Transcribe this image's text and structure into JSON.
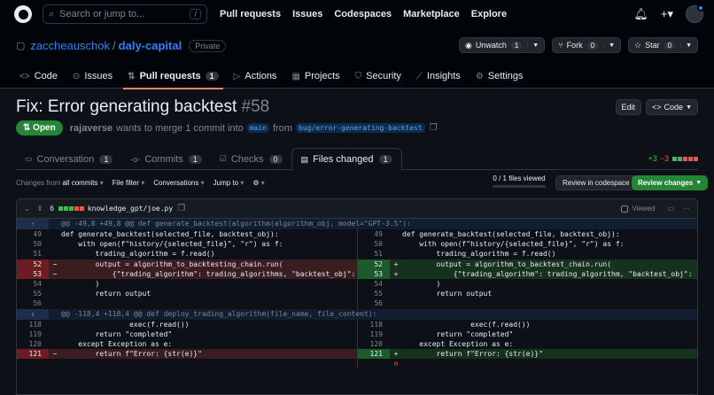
{
  "topbar": {
    "search_placeholder": "Search or jump to...",
    "search_key": "/",
    "nav": [
      "Pull requests",
      "Issues",
      "Codespaces",
      "Marketplace",
      "Explore"
    ]
  },
  "repo": {
    "owner": "zaccheauschok",
    "name": "daly-capital",
    "visibility": "Private",
    "unwatch_label": "Unwatch",
    "unwatch_count": "1",
    "fork_label": "Fork",
    "fork_count": "0",
    "star_label": "Star",
    "star_count": "0"
  },
  "repo_tabs": [
    {
      "label": "Code",
      "icon": "code-icon"
    },
    {
      "label": "Issues",
      "icon": "issues-icon"
    },
    {
      "label": "Pull requests",
      "count": "1",
      "icon": "pull-request-icon"
    },
    {
      "label": "Actions",
      "icon": "actions-icon"
    },
    {
      "label": "Projects",
      "icon": "projects-icon"
    },
    {
      "label": "Security",
      "icon": "shield-icon"
    },
    {
      "label": "Insights",
      "icon": "graph-icon"
    },
    {
      "label": "Settings",
      "icon": "gear-icon"
    }
  ],
  "pr": {
    "title": "Fix: Error generating backtest",
    "number": "#58",
    "edit_label": "Edit",
    "code_label": "Code",
    "state": "Open",
    "author": "rajaverse",
    "meta_text": "wants to merge 1 commit into",
    "base_branch": "main",
    "from_text": "from",
    "head_branch": "bug/error-generating-backtest"
  },
  "pr_tabs": [
    {
      "label": "Conversation",
      "count": "1"
    },
    {
      "label": "Commits",
      "count": "1"
    },
    {
      "label": "Checks",
      "count": "0"
    },
    {
      "label": "Files changed",
      "count": "1"
    }
  ],
  "diffstat": {
    "additions": "+3",
    "deletions": "−3"
  },
  "toolbar": {
    "changes_from": "Changes from",
    "changes_value": "all commits",
    "file_filter": "File filter",
    "conversations": "Conversations",
    "jump_to": "Jump to",
    "viewed_text": "0 / 1 files viewed",
    "viewed_fraction": 0,
    "review_codespace": "Review in codespace",
    "review_changes": "Review changes"
  },
  "file": {
    "changed_lines": "6",
    "path": "knowledge_gpt/joe.py",
    "viewed_label": "Viewed",
    "more": "···"
  },
  "hunks": [
    {
      "header": "@@ -49,8 +49,8 @@ def generate_backtest(algorithm(algorithm_obj, model=\"GPT-3.5\"):",
      "lines": [
        {
          "t": "ctx",
          "l": "49",
          "r": "49",
          "lc": "def generate_backtest(selected_file, backtest_obj):",
          "rc": "def generate_backtest(selected_file, backtest_obj):"
        },
        {
          "t": "ctx",
          "l": "50",
          "r": "50",
          "lc": "    with open(f\"history/{selected_file}\", \"r\") as f:",
          "rc": "    with open(f\"history/{selected_file}\", \"r\") as f:"
        },
        {
          "t": "ctx",
          "l": "51",
          "r": "51",
          "lc": "        trading_algorithm = f.read()",
          "rc": "        trading_algorithm = f.read()"
        },
        {
          "t": "chg",
          "l": "52",
          "r": "52",
          "lc": "        output = algorithm_to_backtesting_chain.run(",
          "rc": "        output = algorithm_to_backtest_chain.run("
        },
        {
          "t": "chg",
          "l": "53",
          "r": "53",
          "lc": "            {\"trading_algorithm\": trading_algorithms, \"backtest_obj\": backtest_obj}",
          "rc": "            {\"trading_algorithm\": trading_algorithm, \"backtest_obj\": backtest_obj}"
        },
        {
          "t": "ctx",
          "l": "54",
          "r": "54",
          "lc": "        )",
          "rc": "        )"
        },
        {
          "t": "ctx",
          "l": "55",
          "r": "55",
          "lc": "        return output",
          "rc": "        return output"
        },
        {
          "t": "ctx",
          "l": "56",
          "r": "56",
          "lc": "",
          "rc": ""
        }
      ]
    },
    {
      "header": "@@ -118,4 +118,4 @@ def deploy_trading_algorithm(file_name, file_content):",
      "lines": [
        {
          "t": "ctx",
          "l": "118",
          "r": "118",
          "lc": "                exec(f.read())",
          "rc": "                exec(f.read())"
        },
        {
          "t": "ctx",
          "l": "119",
          "r": "119",
          "lc": "        return \"completed\"",
          "rc": "        return \"completed\""
        },
        {
          "t": "ctx",
          "l": "120",
          "r": "120",
          "lc": "    except Exception as e:",
          "rc": "    except Exception as e:"
        },
        {
          "t": "chg",
          "l": "121",
          "r": "121",
          "lc": "        return f\"Error: {str(e)}\"",
          "rc": "        return f\"Error: {str(e)}\""
        }
      ]
    }
  ],
  "colors": {
    "accent": "#2f81f7",
    "open_green": "#238636",
    "tab_underline": "#f78166",
    "deletion": "#f85149",
    "addition": "#3fb950"
  }
}
